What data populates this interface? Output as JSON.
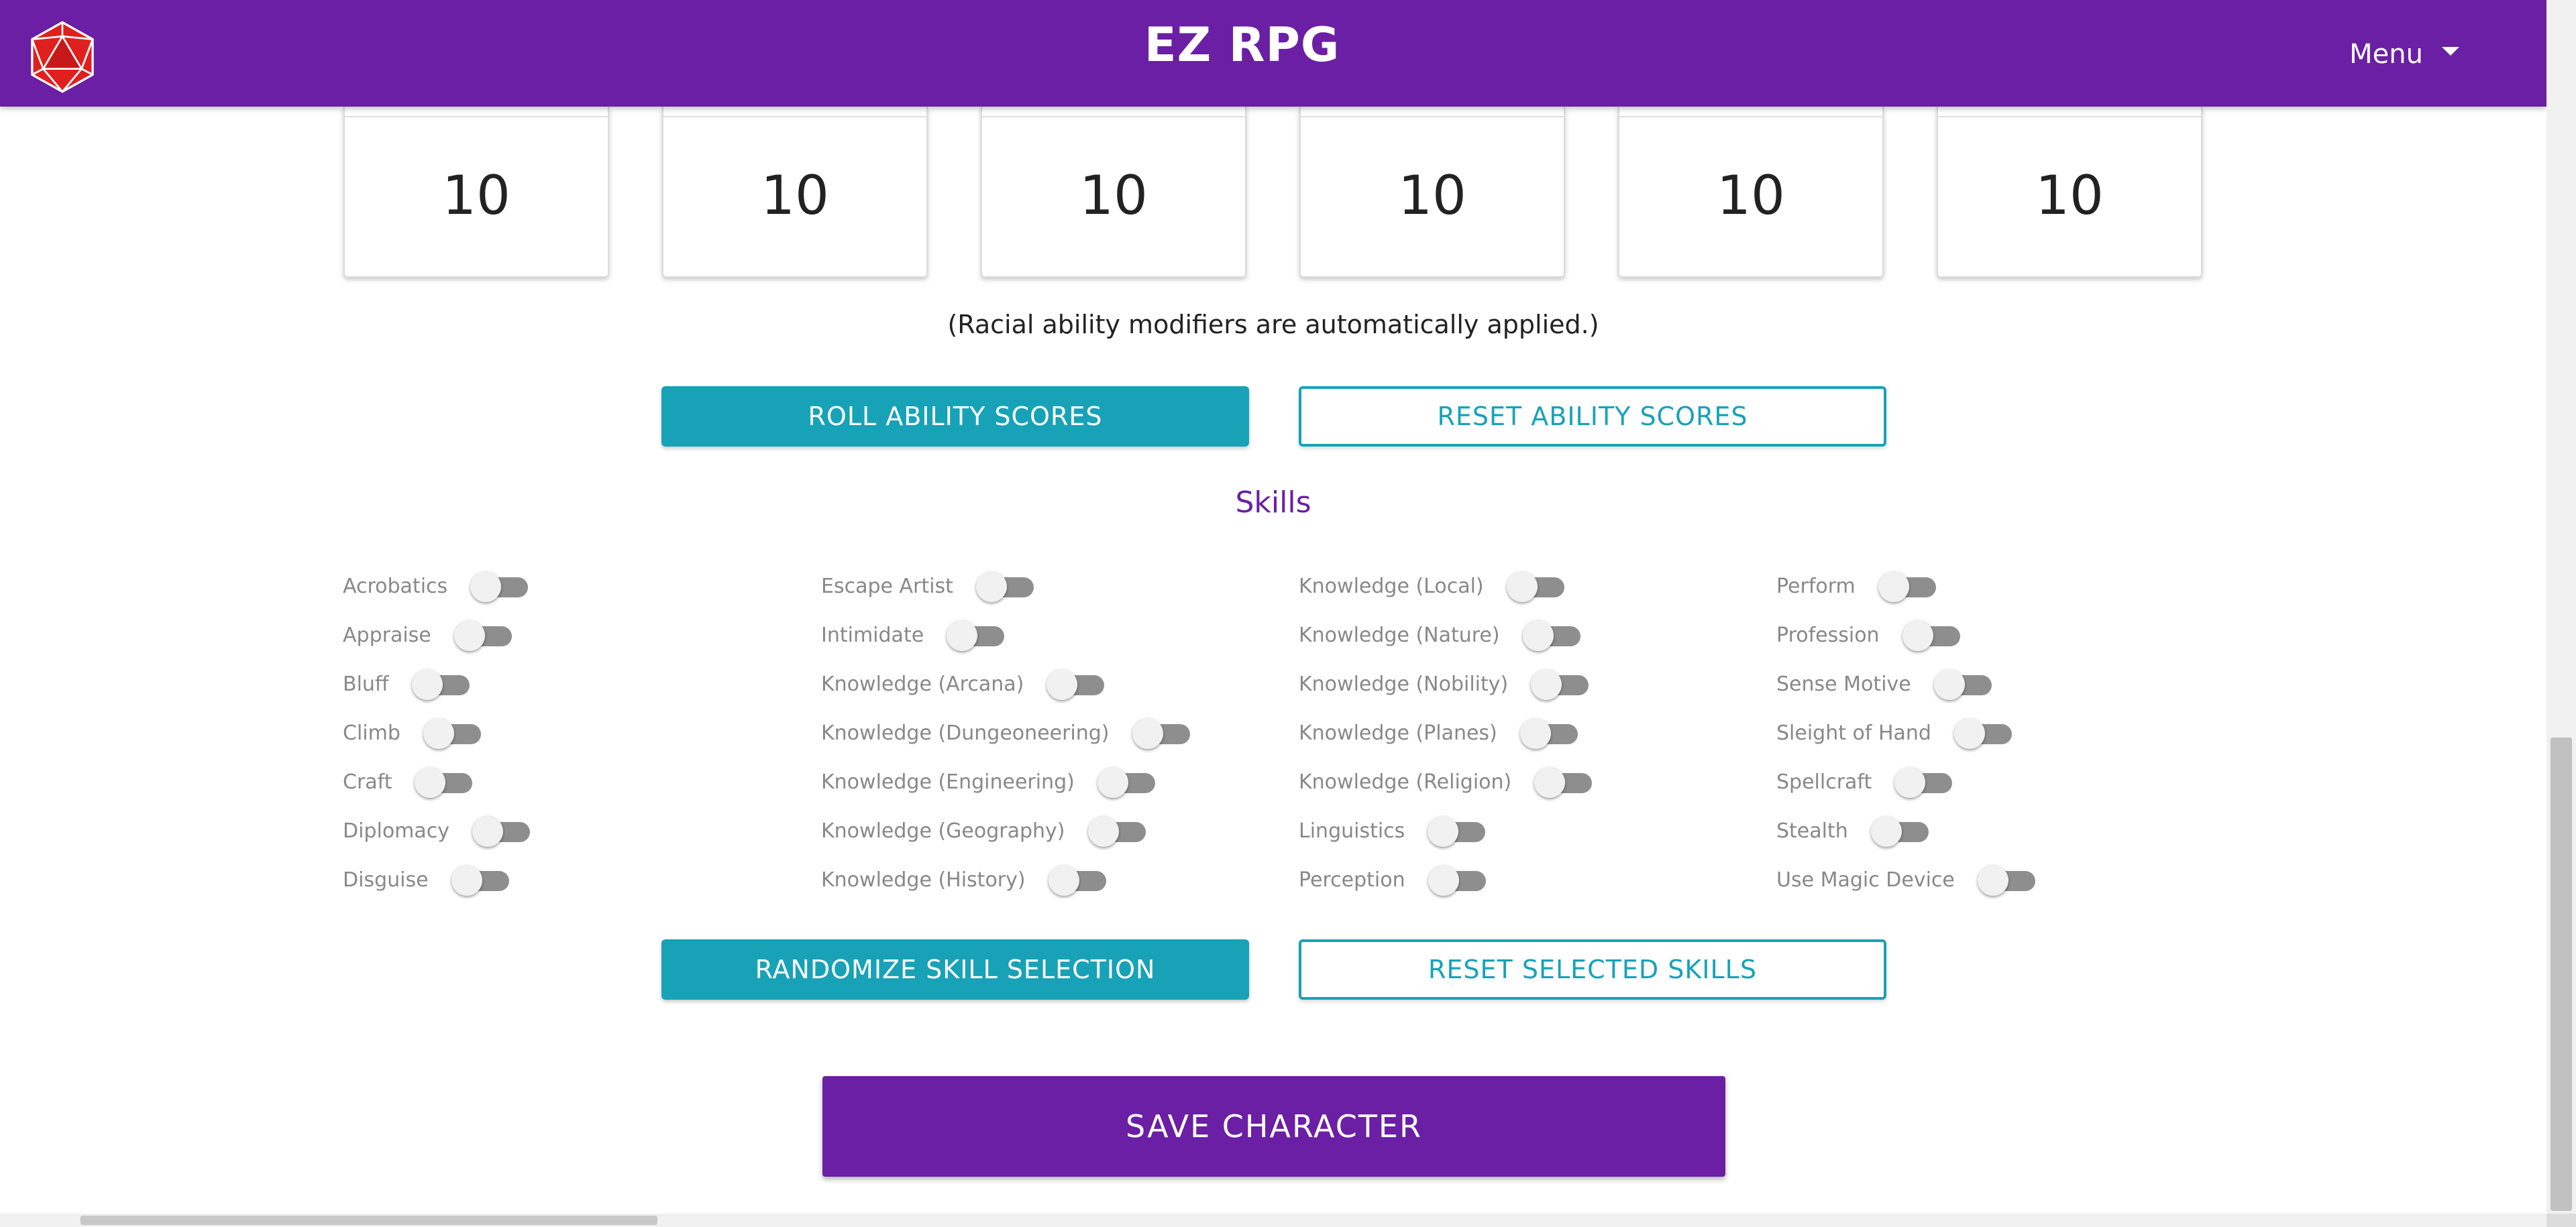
{
  "header": {
    "brand": "EZ RPG",
    "menu_label": "Menu"
  },
  "ability_scores": [
    {
      "value": "10"
    },
    {
      "value": "10"
    },
    {
      "value": "10"
    },
    {
      "value": "10"
    },
    {
      "value": "10"
    },
    {
      "value": "10"
    }
  ],
  "ability_note": "(Racial ability modifiers are automatically applied.)",
  "ability_buttons": {
    "roll": "ROLL ABILITY SCORES",
    "reset": "RESET ABILITY SCORES"
  },
  "skills": {
    "title": "Skills",
    "columns": [
      [
        "Acrobatics",
        "Appraise",
        "Bluff",
        "Climb",
        "Craft",
        "Diplomacy",
        "Disguise"
      ],
      [
        "Escape Artist",
        "Intimidate",
        "Knowledge (Arcana)",
        "Knowledge (Dungeoneering)",
        "Knowledge (Engineering)",
        "Knowledge (Geography)",
        "Knowledge (History)"
      ],
      [
        "Knowledge (Local)",
        "Knowledge (Nature)",
        "Knowledge (Nobility)",
        "Knowledge (Planes)",
        "Knowledge (Religion)",
        "Linguistics",
        "Perception"
      ],
      [
        "Perform",
        "Profession",
        "Sense Motive",
        "Sleight of Hand",
        "Spellcraft",
        "Stealth",
        "Use Magic Device"
      ]
    ],
    "toggle_state": "off"
  },
  "skill_buttons": {
    "randomize": "RANDOMIZE SKILL SELECTION",
    "reset": "RESET SELECTED SKILLS"
  },
  "save_label": "SAVE CHARACTER",
  "colors": {
    "navbar": "#6a1fa4",
    "accent": "#17a2b8",
    "logo": "#e0201e"
  }
}
